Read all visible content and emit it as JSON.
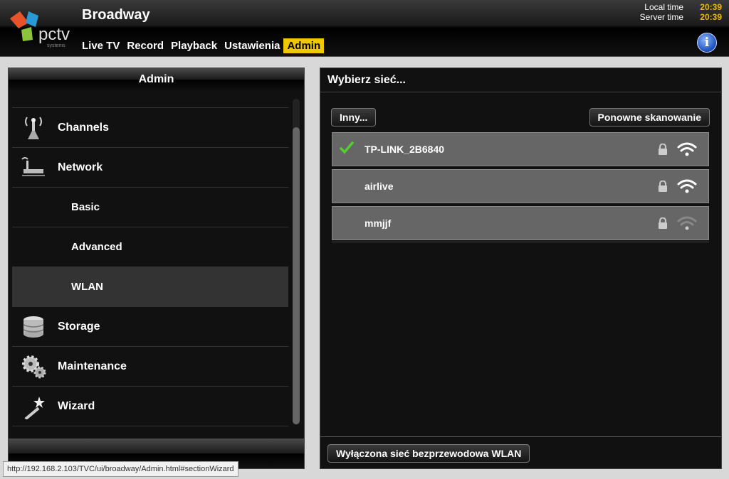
{
  "header": {
    "title": "Broadway",
    "logo_text": "pctv",
    "logo_sub": "systems",
    "nav": [
      "Live TV",
      "Record",
      "Playback",
      "Ustawienia",
      "Admin"
    ],
    "active_nav": "Admin",
    "local_time_label": "Local time",
    "local_time": "20:39",
    "server_time_label": "Server time",
    "server_time": "20:39",
    "info_icon": "i"
  },
  "left_panel": {
    "title": "Admin",
    "items": [
      {
        "label": "Channels",
        "icon": "antenna-icon"
      },
      {
        "label": "Network",
        "icon": "router-icon"
      },
      {
        "label": "Basic"
      },
      {
        "label": "Advanced"
      },
      {
        "label": "WLAN",
        "selected": true
      },
      {
        "label": "Storage",
        "icon": "database-icon"
      },
      {
        "label": "Maintenance",
        "icon": "gears-icon"
      },
      {
        "label": "Wizard",
        "icon": "magic-wand-icon"
      }
    ]
  },
  "right_panel": {
    "title": "Wybierz sieć...",
    "other_button": "Inny...",
    "rescan_button": "Ponowne skanowanie",
    "networks": [
      {
        "name": "TP-LINK_2B6840",
        "connected": true,
        "locked": true,
        "signal": 3
      },
      {
        "name": "airlive",
        "connected": false,
        "locked": true,
        "signal": 3
      },
      {
        "name": "mmjjf",
        "connected": false,
        "locked": true,
        "signal": 1
      }
    ],
    "disable_button": "Wyłączona sieć bezprzewodowa WLAN"
  },
  "status_bar": {
    "url": "http://192.168.2.103/TVC/ui/broadway/Admin.html#sectionWizard"
  },
  "colors": {
    "accent": "#f0c800",
    "time": "#f0b800",
    "check": "#55cc33"
  }
}
